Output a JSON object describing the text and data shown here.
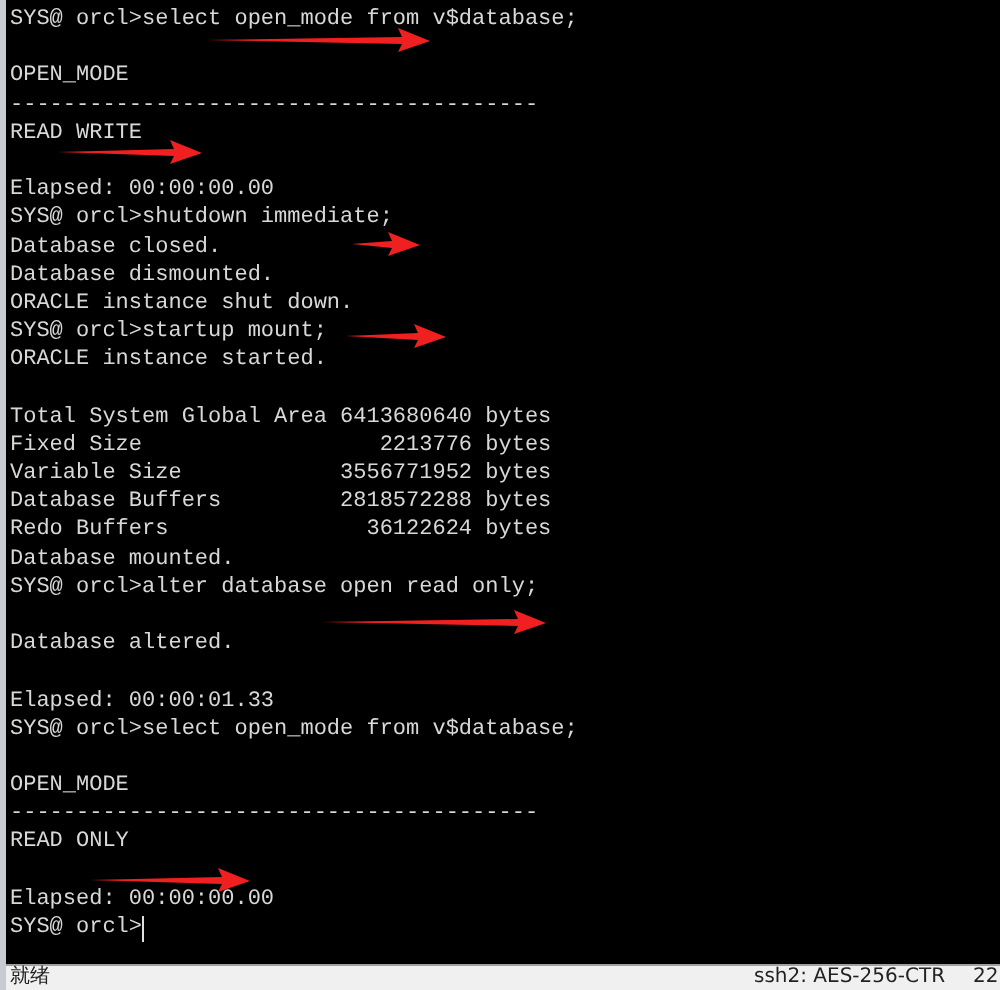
{
  "terminal": {
    "lines": [
      {
        "kind": "text",
        "text": "SYS@ orcl>select open_mode from v$database;"
      },
      {
        "kind": "blank"
      },
      {
        "kind": "text",
        "text": "OPEN_MODE"
      },
      {
        "kind": "text",
        "text": "----------------------------------------"
      },
      {
        "kind": "text",
        "text": "READ WRITE"
      },
      {
        "kind": "blank"
      },
      {
        "kind": "text",
        "text": "Elapsed: 00:00:00.00"
      },
      {
        "kind": "text",
        "text": "SYS@ orcl>shutdown immediate;"
      },
      {
        "kind": "text",
        "text": "Database closed."
      },
      {
        "kind": "text",
        "text": "Database dismounted."
      },
      {
        "kind": "text",
        "text": "ORACLE instance shut down."
      },
      {
        "kind": "text",
        "text": "SYS@ orcl>startup mount;"
      },
      {
        "kind": "text",
        "text": "ORACLE instance started."
      },
      {
        "kind": "blank"
      },
      {
        "kind": "text",
        "text": "Total System Global Area 6413680640 bytes"
      },
      {
        "kind": "text",
        "text": "Fixed Size                  2213776 bytes"
      },
      {
        "kind": "text",
        "text": "Variable Size            3556771952 bytes"
      },
      {
        "kind": "text",
        "text": "Database Buffers         2818572288 bytes"
      },
      {
        "kind": "text",
        "text": "Redo Buffers               36122624 bytes"
      },
      {
        "kind": "text",
        "text": "Database mounted."
      },
      {
        "kind": "text",
        "text": "SYS@ orcl>alter database open read only;"
      },
      {
        "kind": "blank"
      },
      {
        "kind": "text",
        "text": "Database altered."
      },
      {
        "kind": "blank"
      },
      {
        "kind": "text",
        "text": "Elapsed: 00:00:01.33"
      },
      {
        "kind": "text",
        "text": "SYS@ orcl>select open_mode from v$database;"
      },
      {
        "kind": "blank"
      },
      {
        "kind": "text",
        "text": "OPEN_MODE"
      },
      {
        "kind": "text",
        "text": "----------------------------------------"
      },
      {
        "kind": "text",
        "text": "READ ONLY"
      },
      {
        "kind": "blank"
      },
      {
        "kind": "text",
        "text": "Elapsed: 00:00:00.00"
      },
      {
        "kind": "prompt",
        "text": "SYS@ orcl>"
      }
    ],
    "annotations": [
      {
        "kind": "arrow"
      },
      {
        "kind": "arrow"
      },
      {
        "kind": "arrow"
      },
      {
        "kind": "arrow"
      },
      {
        "kind": "arrow"
      },
      {
        "kind": "arrow"
      }
    ]
  },
  "status_bar": {
    "left": "就绪",
    "connection": "ssh2: AES-256-CTR",
    "column": "22"
  }
}
